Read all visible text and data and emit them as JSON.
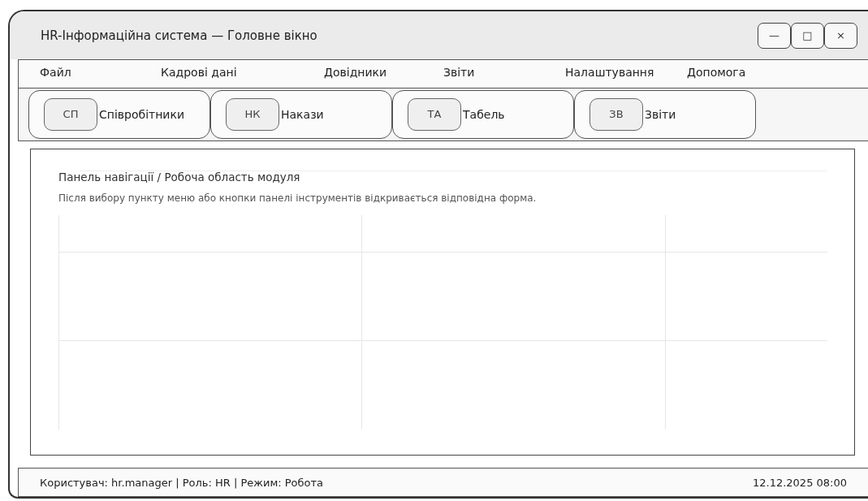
{
  "window": {
    "title": "HR-Інформаційна система — Головне вікно",
    "controls": [
      "—",
      "□",
      "×"
    ]
  },
  "menu": [
    "Файл",
    "Кадрові дані",
    "Довідники",
    "Звіти",
    "Налаштування",
    "Допомога"
  ],
  "toolbar": [
    {
      "badge": "СП",
      "label": "Співробітники"
    },
    {
      "badge": "НК",
      "label": "Накази"
    },
    {
      "badge": "ТА",
      "label": "Табель"
    },
    {
      "badge": "ЗВ",
      "label": "Звіти"
    }
  ],
  "workspace": {
    "heading": "Панель навігації / Робоча область модуля",
    "description": "Після вибору пункту меню або кнопки панелі інструментів відкривається відповідна форма."
  },
  "status_bar": {
    "info": "Користувач: hr.manager | Роль: HR | Режим: Робота",
    "datetime": "12.12.2025 08:00"
  }
}
